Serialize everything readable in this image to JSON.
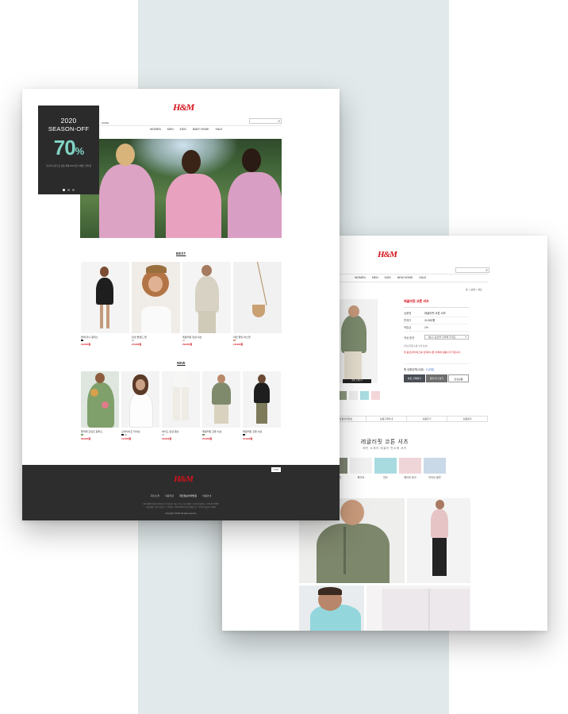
{
  "page1": {
    "logo": "H&M",
    "breadcrumb": "HOME",
    "nav": [
      "WOMEN",
      "MEN",
      "KIDS",
      "BABY HOME",
      "SALE"
    ],
    "banner": {
      "year": "2020",
      "title": "SEASON-OFF",
      "percent": "70",
      "percent_sign": "%",
      "note": "기간 내 시즌오프 상품 최대 70% 할인 이벤트 진행 중"
    },
    "sections": {
      "best": "BEST",
      "new": "NEW"
    },
    "best_products": [
      {
        "name": "블랙 미니 원피스",
        "price": "19,900원"
      },
      {
        "name": "린넨 블렌드 탑",
        "price": "24,900원"
      },
      {
        "name": "레귤러핏 린넨 셔츠",
        "price": "29,900원"
      },
      {
        "name": "라탄 행잉 바스켓",
        "price": "19,900원"
      }
    ],
    "new_products": [
      {
        "name": "플라워 프린트 원피스",
        "price": "39,900원"
      },
      {
        "name": "오버사이즈 티셔츠",
        "price": "12,900원"
      },
      {
        "name": "와이드 린넨 팬츠",
        "price": "29,900원"
      },
      {
        "name": "레귤러핏 코튼 셔츠",
        "price": "24,900원"
      },
      {
        "name": "레귤러핏 코튼 셔츠",
        "price": "24,900원"
      }
    ],
    "footer": {
      "logo": "H&M",
      "top_button": "TOP",
      "links": [
        "회사소개",
        "이용약관",
        "개인정보처리방침",
        "이용안내"
      ],
      "info": [
        "에이치앤엠 헤네스앤모리츠 주식회사 | 대표 : 안나 가브리엘손 | 사업자등록번호 : 120-87-56399",
        "서울특별시 중구 을지로 | 고객센터 : 1600-4000 | 통신판매업신고 : 2010-서울중구-0000"
      ],
      "copyright": "Copyright © H&M. All rights reserved."
    }
  },
  "page2": {
    "logo": "H&M",
    "nav": [
      "WOMEN",
      "MEN",
      "KIDS",
      "NEW HOME",
      "SALE"
    ],
    "breadcrumb": "홈 > 남성 > 셔츠",
    "product_title": "레귤러핏 코튼 셔츠",
    "info_rows": [
      {
        "k": "상품명",
        "v": "레귤러핏 코튼 셔츠"
      },
      {
        "k": "판매가",
        "v": "24,900원"
      },
      {
        "k": "적립금",
        "v": "1%"
      }
    ],
    "option_label": "색상 옵션",
    "option_placeholder": "- [필수] 옵션을 선택해 주세요 -",
    "option_note": "(최소주문수량 1개 이상)",
    "option_warn": "위 옵션선택 박스를 선택하시면 아래에 상품이 추가됩니다.",
    "total_label": "총 상품금액(수량) :",
    "total_value": "0 (0개)",
    "buttons": [
      "바로 구매하기",
      "장바구니 담기",
      "관심상품"
    ],
    "tabs": [
      "상품상세정보",
      "상품구매안내",
      "상품후기",
      "상품문의"
    ],
    "detail_title": "레귤러핏 코튼 셔츠",
    "detail_sub": "깨끗 소재의 레귤러 반소매 셔츠",
    "colors": [
      {
        "name": "카키 그린",
        "hex": "#7f8574"
      },
      {
        "name": "화이트",
        "hex": "#f1f1f1"
      },
      {
        "name": "민트",
        "hex": "#a8dbe0"
      },
      {
        "name": "베이비 핑크",
        "hex": "#f0d5d8"
      },
      {
        "name": "라이트 블루",
        "hex": "#c9d9e8"
      }
    ],
    "thumb_label": "상품 크게보기"
  }
}
